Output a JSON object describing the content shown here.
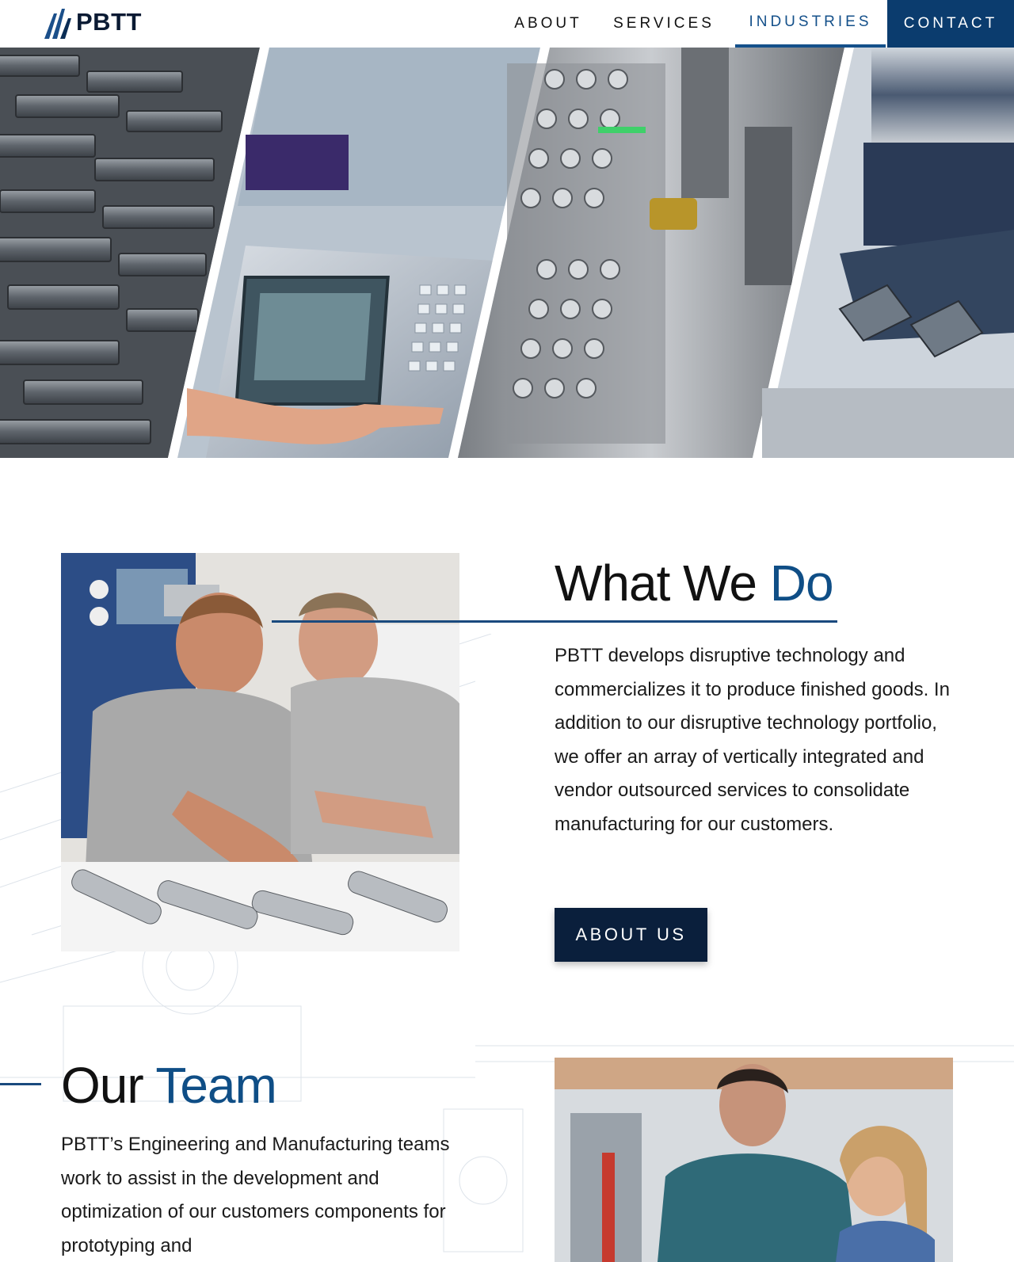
{
  "brand": {
    "name": "PBTT"
  },
  "nav": {
    "items": [
      {
        "label": "ABOUT"
      },
      {
        "label": "SERVICES"
      },
      {
        "label": "INDUSTRIES",
        "active": true
      },
      {
        "label": "CONTACT"
      }
    ]
  },
  "what_we_do": {
    "title_part1": "What We ",
    "title_accent": "Do",
    "body": "PBTT develops disruptive technology and commercializes it to produce finished goods. In addition to our disruptive technology portfolio, we offer an array of vertically integrated and vendor outsourced services to consolidate manufacturing for our customers.",
    "button_label": "ABOUT US"
  },
  "our_team": {
    "title_part1": "Our ",
    "title_accent": "Team",
    "body": "PBTT’s Engineering and Manufacturing teams work to assist in the development and optimization of our customers components for prototyping and"
  },
  "colors": {
    "accent": "#0f4e86",
    "navy": "#0a1f3c",
    "contact_bg": "#0b3c6e"
  }
}
